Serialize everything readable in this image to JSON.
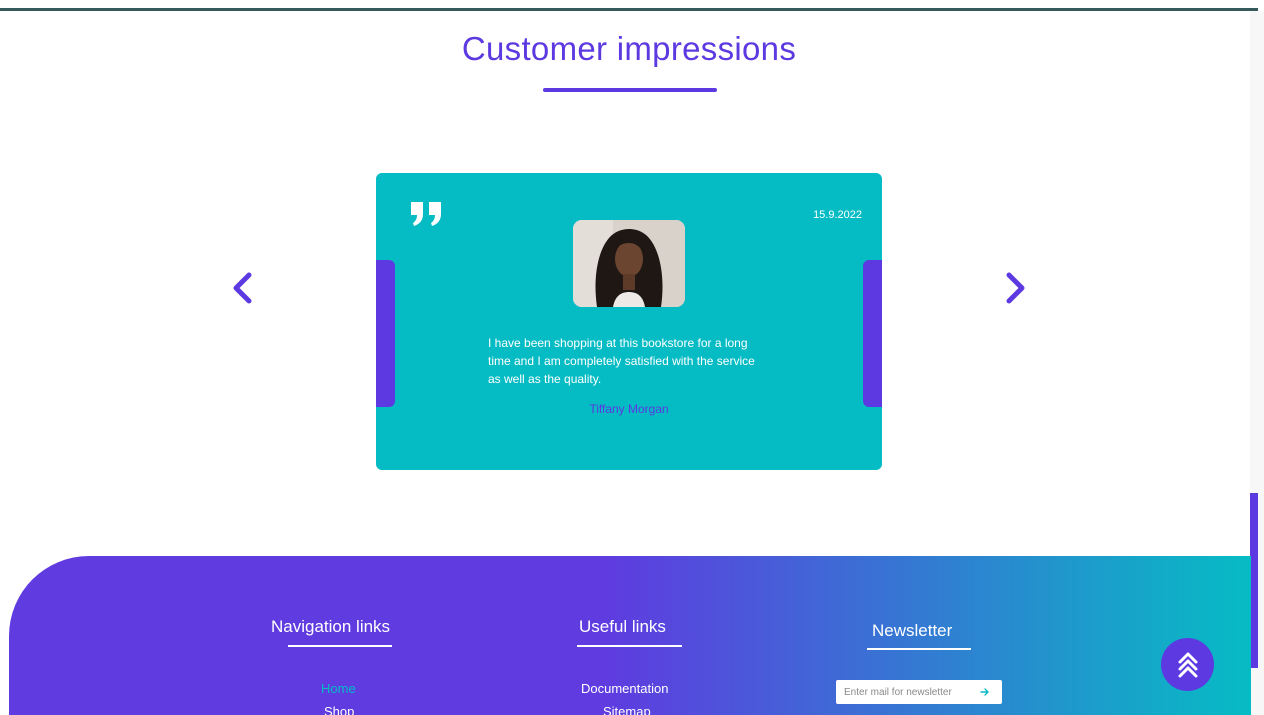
{
  "testimonials": {
    "title": "Customer impressions",
    "card": {
      "date": "15.9.2022",
      "text": "I have been shopping at this bookstore for a long time and I am completely satisfied with the service as well as the quality.",
      "author": "Tiffany Morgan"
    },
    "icons": {
      "prev": "chevron-left-icon",
      "next": "chevron-right-icon",
      "quote": "quote-icon"
    }
  },
  "footer": {
    "navigation": {
      "heading": "Navigation links",
      "links": [
        "Home",
        "Shop"
      ],
      "active_link": "Home"
    },
    "useful": {
      "heading": "Useful links",
      "links": [
        "Documentation",
        "Sitemap"
      ]
    },
    "newsletter": {
      "heading": "Newsletter",
      "placeholder": "Enter mail for newsletter",
      "submit_icon": "arrow-right-icon"
    }
  },
  "back_to_top_icon": "double-chevron-up-icon",
  "colors": {
    "primary": "#5c39e0",
    "teal": "#06bcc4",
    "white": "#ffffff",
    "top_bar": "#355a5a"
  }
}
